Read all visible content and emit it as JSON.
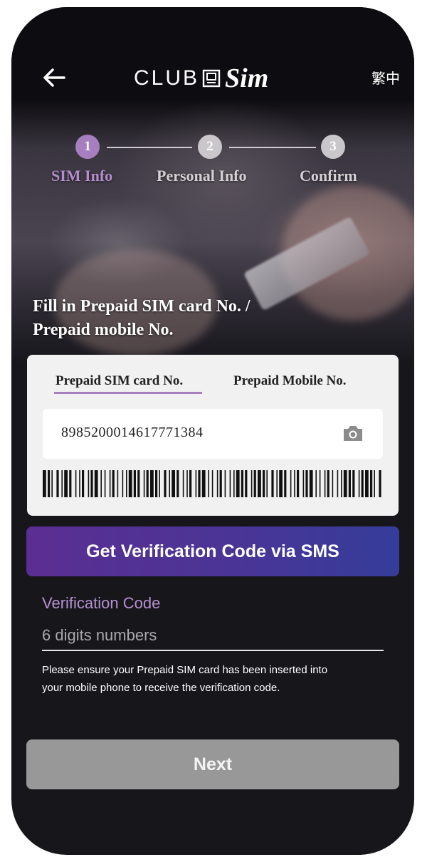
{
  "header": {
    "logo_text": "CLUB Sim",
    "logo_club": "CLUB",
    "logo_sim": "Sim",
    "language_toggle": "繁中",
    "back_icon": "back-arrow-icon"
  },
  "steps": [
    {
      "number": "1",
      "label": "SIM Info",
      "active": true
    },
    {
      "number": "2",
      "label": "Personal Info",
      "active": false
    },
    {
      "number": "3",
      "label": "Confirm",
      "active": false
    }
  ],
  "form": {
    "title_line1": "Fill in Prepaid SIM card No. /",
    "title_line2": "Prepaid mobile No.",
    "tabs": [
      {
        "label": "Prepaid SIM card No.",
        "selected": true
      },
      {
        "label": "Prepaid Mobile No.",
        "selected": false
      }
    ],
    "sim_number": "8985200014617771384",
    "camera_icon": "camera-icon",
    "sms_button": "Get Verification Code via SMS",
    "verification_label": "Verification Code",
    "verification_placeholder": "6 digits numbers",
    "verification_value": "",
    "note_line1": "Please ensure your Prepaid SIM card has been inserted into",
    "note_line2": "your mobile phone to receive the verification code.",
    "next_button": "Next"
  },
  "colors": {
    "accent_purple": "#a67fc0",
    "step_active": "#a77fc0",
    "step_inactive": "#c9c6cc",
    "background_dark": "#17161b",
    "button_gradient_start": "#5b2e92",
    "button_gradient_end": "#353c9a",
    "next_disabled": "#989898"
  }
}
